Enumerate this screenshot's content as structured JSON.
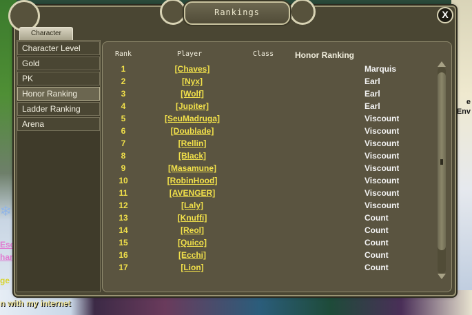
{
  "window": {
    "title": "Rankings",
    "close_label": "X"
  },
  "tab": {
    "label": "Character"
  },
  "sidebar": {
    "items": [
      {
        "label": "Character Level"
      },
      {
        "label": "Gold"
      },
      {
        "label": "PK"
      },
      {
        "label": "Honor Ranking",
        "active": true
      },
      {
        "label": "Ladder Ranking"
      },
      {
        "label": "Arena"
      }
    ]
  },
  "table": {
    "headers": {
      "rank": "Rank",
      "player": "Player",
      "class": "Class",
      "honor": "Honor Ranking"
    },
    "rows": [
      {
        "rank": "1",
        "player": "[Chaves]",
        "honor": "Marquis"
      },
      {
        "rank": "2",
        "player": "[Nyx]",
        "honor": "Earl"
      },
      {
        "rank": "3",
        "player": "[Wolf]",
        "honor": "Earl"
      },
      {
        "rank": "4",
        "player": "[Jupiter]",
        "honor": "Earl"
      },
      {
        "rank": "5",
        "player": "[SeuMadruga]",
        "honor": "Viscount"
      },
      {
        "rank": "6",
        "player": "[Doublade]",
        "honor": "Viscount"
      },
      {
        "rank": "7",
        "player": "[Rellin]",
        "honor": "Viscount"
      },
      {
        "rank": "8",
        "player": "[Black]",
        "honor": "Viscount"
      },
      {
        "rank": "9",
        "player": "[Masamune]",
        "honor": "Viscount"
      },
      {
        "rank": "10",
        "player": "[RobinHood]",
        "honor": "Viscount"
      },
      {
        "rank": "11",
        "player": "[AVENGER]",
        "honor": "Viscount"
      },
      {
        "rank": "12",
        "player": "[Laly]",
        "honor": "Viscount"
      },
      {
        "rank": "13",
        "player": "[Knuffi]",
        "honor": "Count"
      },
      {
        "rank": "14",
        "player": "[Reol]",
        "honor": "Count"
      },
      {
        "rank": "15",
        "player": "[Quico]",
        "honor": "Count"
      },
      {
        "rank": "16",
        "player": "[Ecchi]",
        "honor": "Count"
      },
      {
        "rank": "17",
        "player": "[Lion]",
        "honor": "Count"
      }
    ]
  },
  "background": {
    "left_fragments": [
      "Esc",
      "har",
      "ge"
    ],
    "right_fragments": [
      "e",
      "Env"
    ],
    "chat_message": "n with my internet"
  }
}
